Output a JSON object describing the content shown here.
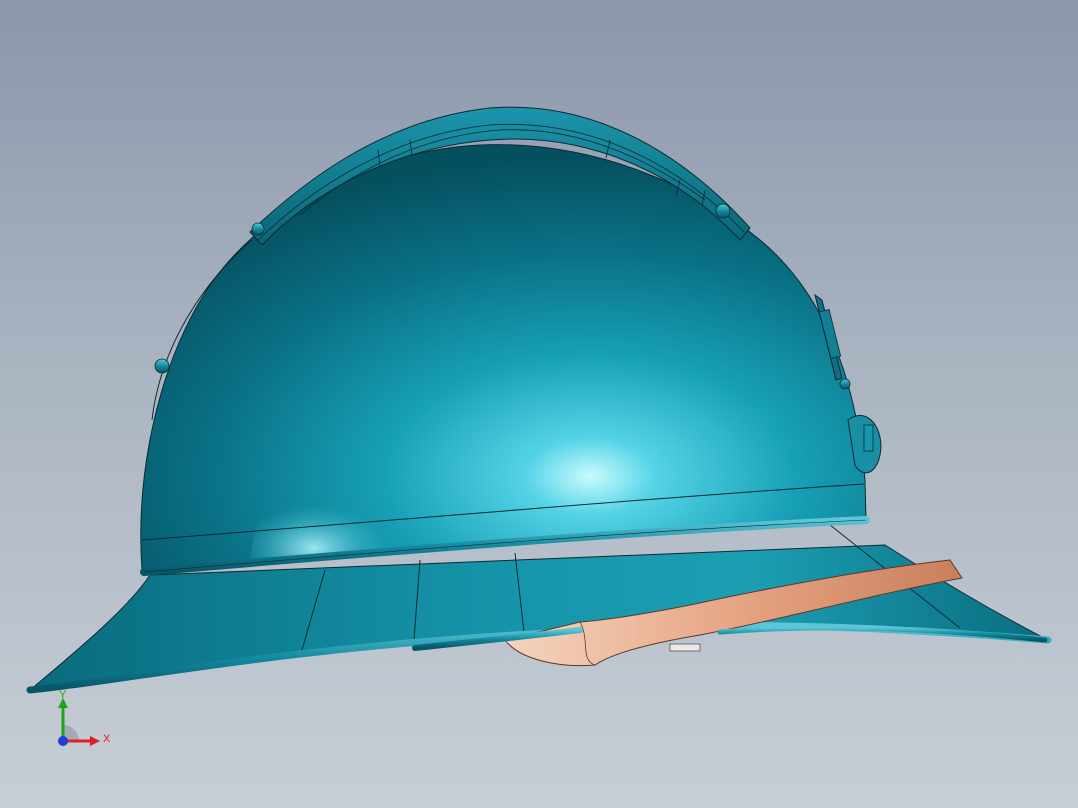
{
  "viewport": {
    "background_top": "#8a97ab",
    "background_bottom": "#c7ced5"
  },
  "model": {
    "body_color": "#0a6f82",
    "highlight_color": "#8fe8f2",
    "strap_color": "#e2a37f",
    "edge_color": "#0c2a33"
  },
  "triad": {
    "x_label": "X",
    "y_label": "Y",
    "x_color": "#e02020",
    "y_color": "#1fa31f",
    "z_color": "#1f3fd6"
  }
}
